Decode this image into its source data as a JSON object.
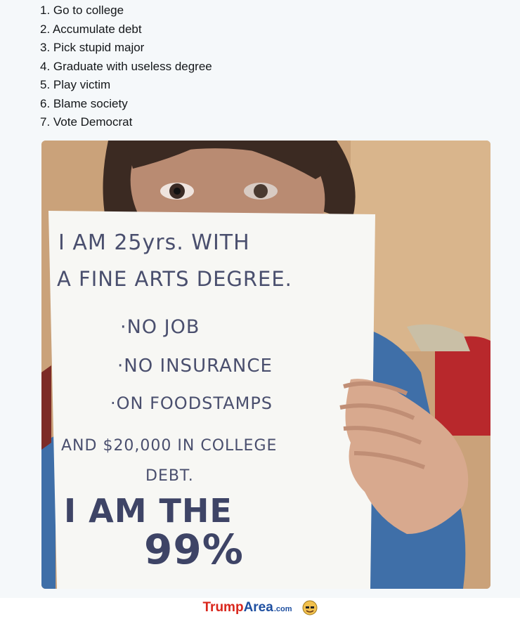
{
  "tweet": {
    "list": [
      "1. Go to college",
      "2. Accumulate debt",
      "3. Pick stupid major",
      "4. Graduate with useless degree",
      "5. Play victim",
      "6. Blame society",
      "7. Vote Democrat"
    ]
  },
  "photo": {
    "sign_lines": [
      "I AM 25yrs. WITH",
      "A FINE ARTS DEGREE.",
      "·NO JOB",
      "·NO INSURANCE",
      "·ON FOODSTAMPS",
      "AND $20,000 IN COLLEGE",
      "DEBT.",
      "I AM THE",
      "99%"
    ]
  },
  "footer": {
    "logo_trump": "Trump",
    "logo_area": "Area",
    "logo_com": ".com",
    "logo_icon": "trump-face-icon"
  },
  "colors": {
    "card_bg": "#f5f8fa",
    "marker_ink": "#4a4f6e",
    "logo_red": "#d9261c",
    "logo_blue": "#1e4fa0"
  }
}
